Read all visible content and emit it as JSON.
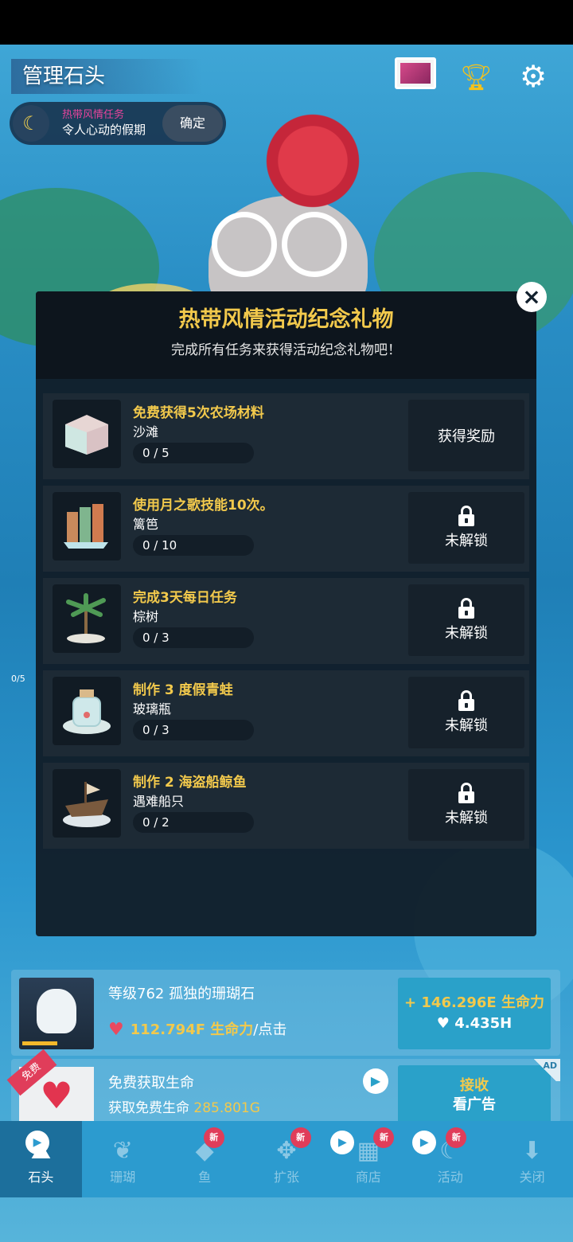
{
  "header": {
    "title": "管理石头",
    "event_pill": {
      "event_name": "热带风情任务",
      "event_subtitle": "令人心动的假期",
      "confirm_label": "确定"
    }
  },
  "modal": {
    "title": "热带风情活动纪念礼物",
    "subtitle": "完成所有任务来获得活动纪念礼物吧！",
    "tasks": [
      {
        "name": "免费获得5次农场材料",
        "item": "沙滩",
        "progress": "0 / 5",
        "action": "获得奖励",
        "locked": false
      },
      {
        "name": "使用月之歌技能10次。",
        "item": "篱笆",
        "progress": "0 / 10",
        "action": "未解锁",
        "locked": true
      },
      {
        "name": "完成3天每日任务",
        "item": "棕树",
        "progress": "0 / 3",
        "action": "未解锁",
        "locked": true
      },
      {
        "name": "制作 3 度假青蛙",
        "item": "玻璃瓶",
        "progress": "0 / 3",
        "action": "未解锁",
        "locked": true
      },
      {
        "name": "制作 2 海盗船鲸鱼",
        "item": "遇难船只",
        "progress": "0 / 2",
        "action": "未解锁",
        "locked": true
      }
    ]
  },
  "side": {
    "counter": "0/5"
  },
  "stone": {
    "name": "等级762 孤独的珊瑚石",
    "tap_value": "112.794F 生命力",
    "tap_suffix": "/点击",
    "upgrade_gain": "+ 146.296E 生命力",
    "upgrade_cost": "♥ 4.435H"
  },
  "free_life": {
    "ribbon": "免费",
    "title": "免费获取生命",
    "desc_prefix": "获取免费生命 ",
    "desc_value": "285.801G",
    "receive_label": "接收",
    "watch_ad_label": "看广告",
    "ad_badge": "AD"
  },
  "nav": {
    "items": [
      {
        "label": "石头",
        "icon": "stone-icon",
        "active": true
      },
      {
        "label": "珊瑚",
        "icon": "coral-icon",
        "active": false
      },
      {
        "label": "鱼",
        "icon": "fish-icon",
        "active": false
      },
      {
        "label": "扩张",
        "icon": "expand-icon",
        "active": false
      },
      {
        "label": "商店",
        "icon": "shop-icon",
        "active": false
      },
      {
        "label": "活动",
        "icon": "event-icon",
        "active": false
      },
      {
        "label": "关闭",
        "icon": "close-down-icon",
        "active": false
      }
    ],
    "new_badge": "新"
  },
  "colors": {
    "accent_gold": "#f2c94c",
    "ocean": "#2c9bcf",
    "modal_bg": "#101a24",
    "event_pink": "#e7449b"
  }
}
